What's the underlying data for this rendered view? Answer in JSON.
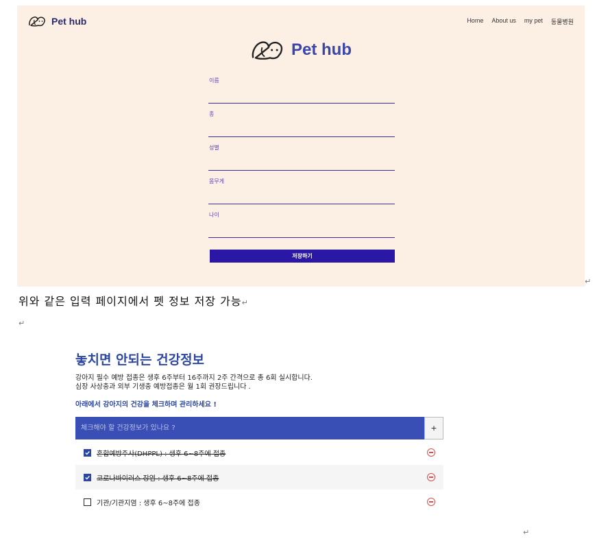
{
  "pethub": {
    "brand": "Pet hub",
    "nav": [
      "Home",
      "About us",
      "my pet",
      "동물병원"
    ],
    "big_brand": "Pet hub",
    "fields": [
      {
        "label": "이름"
      },
      {
        "label": "종"
      },
      {
        "label": "성별"
      },
      {
        "label": "몸무게"
      },
      {
        "label": "나이"
      }
    ],
    "save_label": "저장하기"
  },
  "doc": {
    "caption": "위와 같은 입력 페이지에서 펫 정보 저장 가능",
    "return_mark": "↵"
  },
  "health": {
    "title": "놓치면 안되는 건강정보",
    "desc_line1": "강아지 필수 예방 접종은 생후 6주부터 16주까지 2주 간격으로 총 6회 실시합니다.",
    "desc_line2": "심장 사상충과 외부 기생충 예방접종은 월 1회 권장드립니다 .",
    "subtitle": "아래에서 강아지의 건강을 체크하며 관리하세요 !",
    "input_placeholder": "체크해야 할 건강정보가 있나요 ?",
    "add_label": "+",
    "items": [
      {
        "text": "혼합예방주사(DHPPL) : 생후 6~8주에 접종",
        "checked": true
      },
      {
        "text": "코로나바이러스 장염 : 생후 6~8주에 접종",
        "checked": true
      },
      {
        "text": "기관/기관지염 : 생후 6~8주에 접종",
        "checked": false
      }
    ]
  },
  "colors": {
    "accent": "#3a46a8",
    "button": "#2a17a6",
    "remove": "#e04a4a",
    "peach": "#fcefe3"
  }
}
